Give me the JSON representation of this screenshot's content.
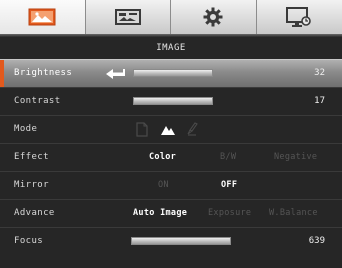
{
  "tabs": [
    {
      "id": "image",
      "icon": "image-icon",
      "active": true
    },
    {
      "id": "display",
      "icon": "display-settings-icon",
      "active": false
    },
    {
      "id": "setup",
      "icon": "gear-icon",
      "active": false
    },
    {
      "id": "output",
      "icon": "monitor-icon",
      "active": false
    }
  ],
  "colors": {
    "accent": "#e2591d",
    "panel": "#262626",
    "selected_row": "#8a8a8a",
    "dim_text": "#555555"
  },
  "panel_title": "IMAGE",
  "rows": {
    "brightness": {
      "label": "Brightness",
      "value": "32"
    },
    "contrast": {
      "label": "Contrast",
      "value": "17"
    },
    "mode": {
      "label": "Mode",
      "icons": [
        "document-mode-icon",
        "photo-mode-icon",
        "marker-mode-icon"
      ],
      "selected": "photo-mode-icon"
    },
    "effect": {
      "label": "Effect",
      "options": [
        "Color",
        "B/W",
        "Negative"
      ],
      "selected": "Color"
    },
    "mirror": {
      "label": "Mirror",
      "options": [
        "ON",
        "OFF"
      ],
      "selected": "OFF"
    },
    "advance": {
      "label": "Advance",
      "options": [
        "Auto Image",
        "Exposure",
        "W.Balance"
      ],
      "selected": "Auto Image"
    },
    "focus": {
      "label": "Focus",
      "value": "639"
    }
  }
}
